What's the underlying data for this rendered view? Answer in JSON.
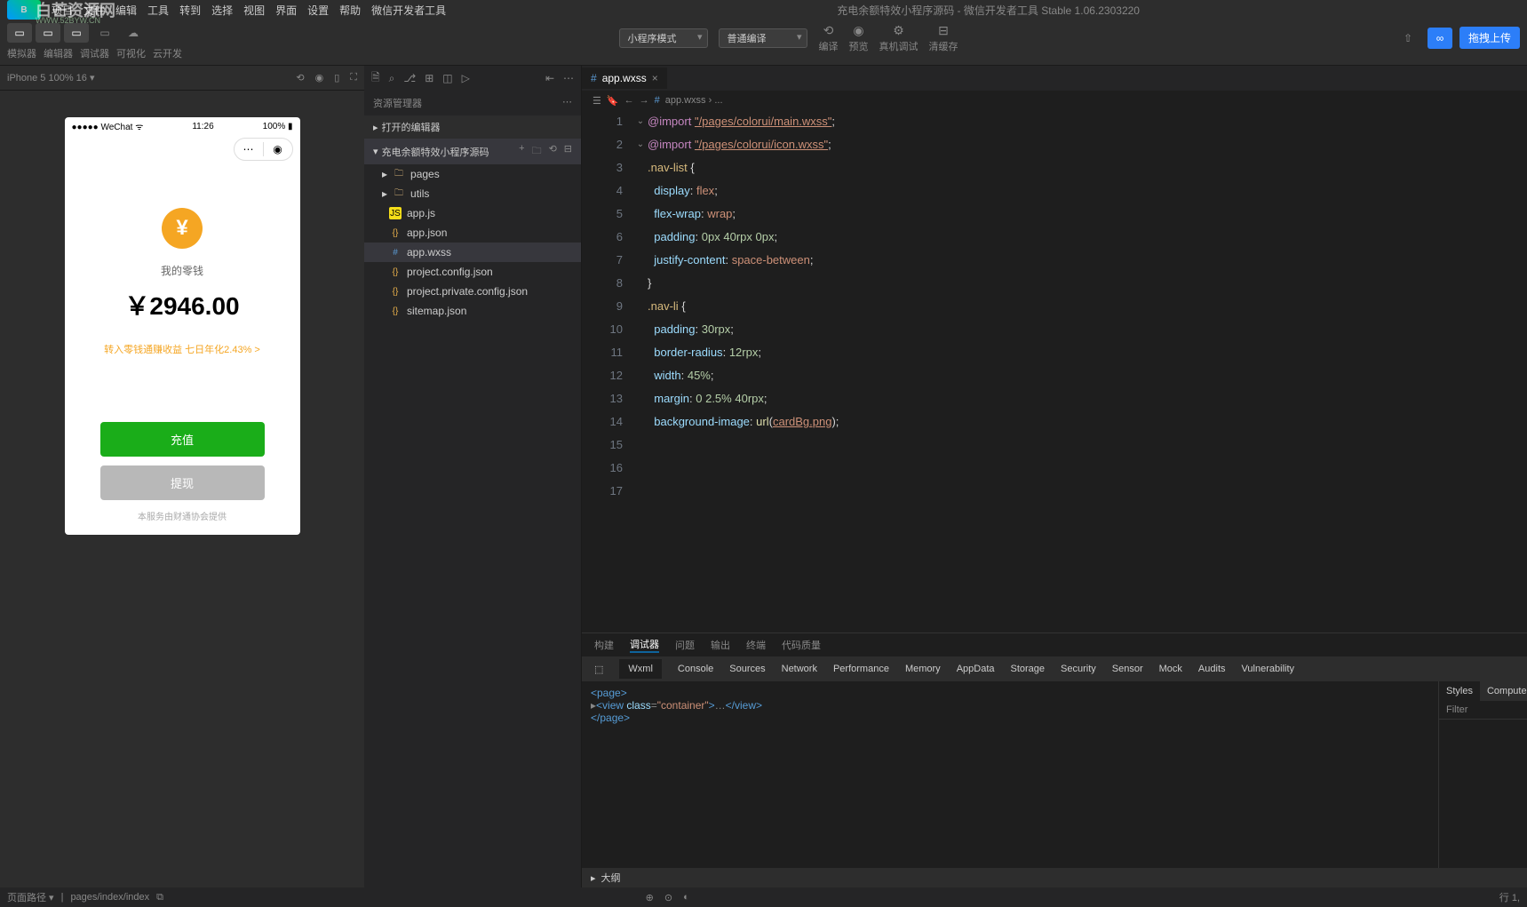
{
  "watermark": {
    "main": "白芒资源网",
    "sub": "WWW.52BYW.CN"
  },
  "menubar": {
    "items": [
      "项目",
      "文件",
      "编辑",
      "工具",
      "转到",
      "选择",
      "视图",
      "界面",
      "设置",
      "帮助",
      "微信开发者工具"
    ],
    "title": "充电余额特效小程序源码 - 微信开发者工具 Stable 1.06.2303220"
  },
  "toolbar": {
    "labels": [
      "模拟器",
      "编辑器",
      "调试器",
      "可视化",
      "云开发"
    ],
    "mode_select": "小程序模式",
    "compile_select": "普通编译",
    "center_actions": [
      "编译",
      "预览",
      "真机调试",
      "清缓存"
    ],
    "upload": "拖拽上传"
  },
  "simulator": {
    "device_info": "iPhone 5 100% 16 ▾",
    "phone": {
      "carrier": "●●●●● WeChat",
      "wifi": "ᯤ",
      "time": "11:26",
      "battery": "100%",
      "yen": "¥",
      "wallet_label": "我的零钱",
      "amount": "￥2946.00",
      "tip": "转入零钱通赚收益 七日年化2.43% >",
      "btn_recharge": "充值",
      "btn_withdraw": "提现",
      "footer": "本服务由财通协会提供"
    }
  },
  "explorer": {
    "title": "资源管理器",
    "section_open": "打开的编辑器",
    "section_project": "充电余额特效小程序源码",
    "tree": [
      {
        "type": "folder",
        "name": "pages",
        "expand": "▸"
      },
      {
        "type": "folder",
        "name": "utils",
        "expand": "▸"
      },
      {
        "type": "js",
        "name": "app.js"
      },
      {
        "type": "json",
        "name": "app.json"
      },
      {
        "type": "wxss",
        "name": "app.wxss",
        "active": true
      },
      {
        "type": "json",
        "name": "project.config.json"
      },
      {
        "type": "json",
        "name": "project.private.config.json"
      },
      {
        "type": "json",
        "name": "sitemap.json"
      }
    ]
  },
  "editor": {
    "tab": {
      "icon": "wxss",
      "name": "app.wxss"
    },
    "breadcrumb": "app.wxss › ...",
    "code_lines": [
      {
        "n": 1,
        "html": "<span class='tok-kw'>@import</span> <span class='tok-str'>\"/pages/colorui/main.wxss\"</span><span class='tok-punc'>;</span>"
      },
      {
        "n": 2,
        "html": "<span class='tok-kw'>@import</span> <span class='tok-str'>\"/pages/colorui/icon.wxss\"</span><span class='tok-punc'>;</span>"
      },
      {
        "n": 3,
        "html": ""
      },
      {
        "n": 4,
        "html": ""
      },
      {
        "n": 5,
        "fold": "⌄",
        "html": "<span class='tok-sel'>.nav-list</span> <span class='tok-punc'>{</span>"
      },
      {
        "n": 6,
        "html": "  <span class='tok-prop'>display</span><span class='tok-punc'>:</span> <span class='tok-val'>flex</span><span class='tok-punc'>;</span>"
      },
      {
        "n": 7,
        "html": "  <span class='tok-prop'>flex-wrap</span><span class='tok-punc'>:</span> <span class='tok-val'>wrap</span><span class='tok-punc'>;</span>"
      },
      {
        "n": 8,
        "html": "  <span class='tok-prop'>padding</span><span class='tok-punc'>:</span> <span class='tok-num'>0px</span> <span class='tok-num'>40rpx</span> <span class='tok-num'>0px</span><span class='tok-punc'>;</span>"
      },
      {
        "n": 9,
        "html": "  <span class='tok-prop'>justify-content</span><span class='tok-punc'>:</span> <span class='tok-val'>space-between</span><span class='tok-punc'>;</span>"
      },
      {
        "n": 10,
        "html": "<span class='tok-punc'>}</span>"
      },
      {
        "n": 11,
        "html": ""
      },
      {
        "n": 12,
        "fold": "⌄",
        "html": "<span class='tok-sel'>.nav-li</span> <span class='tok-punc'>{</span>"
      },
      {
        "n": 13,
        "html": "  <span class='tok-prop'>padding</span><span class='tok-punc'>:</span> <span class='tok-num'>30rpx</span><span class='tok-punc'>;</span>"
      },
      {
        "n": 14,
        "html": "  <span class='tok-prop'>border-radius</span><span class='tok-punc'>:</span> <span class='tok-num'>12rpx</span><span class='tok-punc'>;</span>"
      },
      {
        "n": 15,
        "html": "  <span class='tok-prop'>width</span><span class='tok-punc'>:</span> <span class='tok-num'>45%</span><span class='tok-punc'>;</span>"
      },
      {
        "n": 16,
        "html": "  <span class='tok-prop'>margin</span><span class='tok-punc'>:</span> <span class='tok-num'>0</span> <span class='tok-num'>2.5%</span> <span class='tok-num'>40rpx</span><span class='tok-punc'>;</span>"
      },
      {
        "n": 17,
        "html": "  <span class='tok-prop'>background-image</span><span class='tok-punc'>:</span> <span class='tok-fn'>url</span><span class='tok-punc'>(</span><span class='tok-str'>cardBg.png</span><span class='tok-punc'>);</span>"
      }
    ]
  },
  "debug": {
    "tabs1": [
      "构建",
      "调试器",
      "问题",
      "输出",
      "终端",
      "代码质量"
    ],
    "tabs1_active": "调试器",
    "tabs2": [
      "Wxml",
      "Console",
      "Sources",
      "Network",
      "Performance",
      "Memory",
      "AppData",
      "Storage",
      "Security",
      "Sensor",
      "Mock",
      "Audits",
      "Vulnerability"
    ],
    "tabs2_active": "Wxml",
    "wxml": {
      "l1": "<page>",
      "l2": "▸<view class=\"container\">…</view>",
      "l3": "</page>"
    },
    "styles_tabs": [
      "Styles",
      "Computed"
    ],
    "filter": "Filter",
    "footer": "大纲"
  },
  "bottombar": {
    "path_label": "页面路径 ▾",
    "path": "pages/index/index",
    "line_info": "行 1,"
  }
}
